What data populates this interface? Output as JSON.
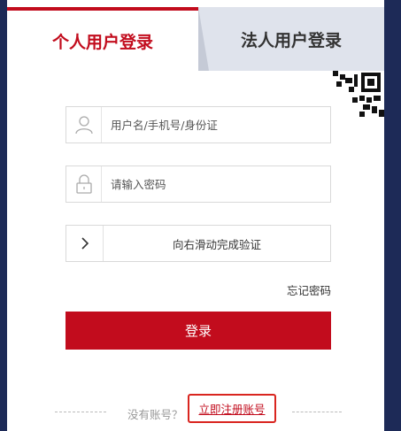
{
  "tabs": [
    {
      "label": "个人用户登录",
      "active": true
    },
    {
      "label": "法人用户登录",
      "active": false
    }
  ],
  "form": {
    "username_placeholder": "用户名/手机号/身份证",
    "password_placeholder": "请输入密码",
    "slider_text": "向右滑动完成验证",
    "forgot_label": "忘记密码",
    "login_label": "登录"
  },
  "footer": {
    "no_account": "没有账号？",
    "register_label": "立即注册账号"
  },
  "icons": {
    "username": "user-icon",
    "password": "lock-icon",
    "slider": "chevron-right-icon",
    "qr": "qr-code-icon"
  },
  "colors": {
    "brand_red": "#c20c1d",
    "background": "#1d2a57",
    "inactive_tab": "#dfe3ec",
    "highlight_box": "#d9251f"
  }
}
